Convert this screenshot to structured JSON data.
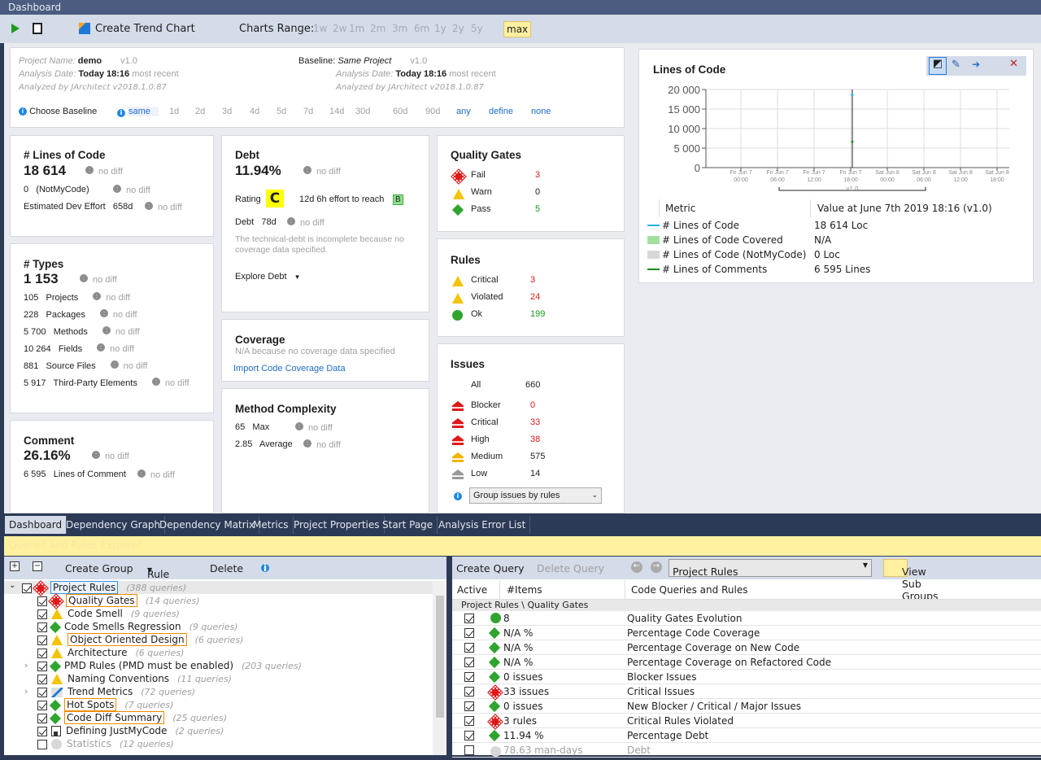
{
  "window": {
    "title": "Dashboard"
  },
  "toolbar": {
    "create_trend_chart": "Create Trend Chart",
    "charts_range_label": "Charts Range:",
    "ranges": [
      "1w",
      "2w",
      "1m",
      "2m",
      "3m",
      "6m",
      "1y",
      "2y",
      "5y",
      "max"
    ],
    "selected_range": "max"
  },
  "project": {
    "name_label": "Project Name:",
    "name": "demo",
    "version": "v1.0",
    "date_label": "Analysis Date:",
    "date": "Today 18:16",
    "recent": "most recent",
    "analyzed": "Analyzed by JArchitect v2018.1.0.87",
    "baseline_label": "Baseline:",
    "baseline": "Same Project",
    "baseline_version": "v1.0",
    "b_date": "Today 18:16",
    "b_recent": "most recent",
    "b_analyzed": "Analyzed by JArchitect v2018.1.0.87",
    "choose_baseline": "Choose Baseline",
    "baseline_options": [
      "same",
      "1d",
      "2d",
      "3d",
      "4d",
      "5d",
      "7d",
      "14d",
      "30d",
      "60d",
      "90d",
      "any",
      "define",
      "none"
    ]
  },
  "nodiff": "no diff",
  "loc": {
    "title": "# Lines of Code",
    "value": "18 614",
    "notmycode_value": "0",
    "notmycode_label": "(NotMyCode)",
    "effort_label": "Estimated Dev Effort",
    "effort": "658d"
  },
  "types": {
    "title": "# Types",
    "value": "1 153",
    "items": [
      {
        "v": "105",
        "l": "Projects"
      },
      {
        "v": "228",
        "l": "Packages"
      },
      {
        "v": "5 700",
        "l": "Methods"
      },
      {
        "v": "10 264",
        "l": "Fields"
      },
      {
        "v": "881",
        "l": "Source Files"
      },
      {
        "v": "5 917",
        "l": "Third-Party Elements"
      }
    ]
  },
  "comment": {
    "title": "Comment",
    "value": "26.16%",
    "lines_value": "6 595",
    "lines_label": "Lines of Comment"
  },
  "debt": {
    "title": "Debt",
    "value": "11.94%",
    "rating_label": "Rating",
    "rating": "C",
    "reach": "12d  6h effort to reach",
    "reach_rating": "B",
    "debt_label": "Debt",
    "debt_value": "78d",
    "note": "The technical-debt is incomplete because no coverage data specified.",
    "explore": "Explore Debt"
  },
  "coverage": {
    "title": "Coverage",
    "note": "N/A because no coverage data specified",
    "import": "Import Code Coverage Data"
  },
  "complexity": {
    "title": "Method Complexity",
    "max_value": "65",
    "max_label": "Max",
    "avg_value": "2.85",
    "avg_label": "Average"
  },
  "quality_gates": {
    "title": "Quality Gates",
    "items": [
      {
        "l": "Fail",
        "v": "3",
        "icon": "fail"
      },
      {
        "l": "Warn",
        "v": "0",
        "icon": "warn"
      },
      {
        "l": "Pass",
        "v": "5",
        "icon": "pass"
      }
    ]
  },
  "rules": {
    "title": "Rules",
    "items": [
      {
        "l": "Critical",
        "v": "3"
      },
      {
        "l": "Violated",
        "v": "24"
      },
      {
        "l": "Ok",
        "v": "199"
      }
    ]
  },
  "issues": {
    "title": "Issues",
    "all_label": "All",
    "all": "660",
    "items": [
      {
        "l": "Blocker",
        "v": "0"
      },
      {
        "l": "Critical",
        "v": "33"
      },
      {
        "l": "High",
        "v": "38"
      },
      {
        "l": "Medium",
        "v": "575"
      },
      {
        "l": "Low",
        "v": "14"
      }
    ],
    "group_select": "Group issues by rules"
  },
  "chart_data": {
    "type": "line",
    "title": "Lines of Code",
    "yticks": [
      "20 000",
      "15 000",
      "10 000",
      "5 000",
      "0"
    ],
    "ylim": [
      0,
      20000
    ],
    "xticks": [
      "Fri Jun 7 00:00",
      "Fri Jun 7 06:00",
      "Fri Jun 7 12:00",
      "Fri Jun 7 18:00",
      "Sat Jun 8 00:00",
      "Sat Jun 8 06:00",
      "Sat Jun 8 12:00",
      "Sat Jun 8 18:00"
    ],
    "version_marker": "v1.0",
    "series": [
      {
        "name": "# Lines of Code",
        "color": "#1eb4f0",
        "x": "Fri Jun 7 18:16",
        "y": 18614
      },
      {
        "name": "# Lines of Comments",
        "color": "#1a8a1a",
        "x": "Fri Jun 7 18:16",
        "y": 6595
      }
    ],
    "table": {
      "col1": "Metric",
      "col2": "Value at June 7th 2019  18:16  (v1.0)",
      "rows": [
        {
          "l": "# Lines of Code",
          "v": "18 614 Loc",
          "color": "#1eb4f0",
          "kind": "line"
        },
        {
          "l": "# Lines of Code Covered",
          "v": "N/A",
          "color": "#a0e0a0",
          "kind": "box"
        },
        {
          "l": "# Lines of Code (NotMyCode)",
          "v": "0 Loc",
          "color": "#d8d8d8",
          "kind": "box"
        },
        {
          "l": "# Lines of Comments",
          "v": "6 595 Lines",
          "color": "#1a8a1a",
          "kind": "line"
        }
      ]
    }
  },
  "tabs": [
    "Dashboard",
    "Dependency Graph",
    "Dependency Matrix",
    "Metrics",
    "Project Properties",
    "Start Page",
    "Analysis Error List"
  ],
  "explorer": {
    "title": "Queries and Rules Explorer",
    "create_group": "Create Group",
    "rule_file": "Rule File",
    "delete": "Delete",
    "tree": [
      {
        "l": "Project Rules",
        "q": "(388 queries)",
        "icon": "fail",
        "boxed": true,
        "on": true,
        "level": 0
      },
      {
        "l": "Quality Gates",
        "q": "(14 queries)",
        "icon": "fail",
        "boxed": true,
        "on": true,
        "level": 1
      },
      {
        "l": "Code Smell",
        "q": "(9 queries)",
        "icon": "warn",
        "on": true,
        "level": 1
      },
      {
        "l": "Code Smells Regression",
        "q": "(9 queries)",
        "icon": "pass",
        "on": true,
        "level": 1
      },
      {
        "l": "Object Oriented Design",
        "q": "(6 queries)",
        "icon": "warn",
        "boxed": true,
        "on": true,
        "level": 1
      },
      {
        "l": "Architecture",
        "q": "(6 queries)",
        "icon": "warn",
        "on": true,
        "level": 1
      },
      {
        "l": "PMD Rules (PMD must be enabled)",
        "q": "(203 queries)",
        "icon": "pass",
        "on": true,
        "level": 1,
        "exp": true
      },
      {
        "l": "Naming Conventions",
        "q": "(11 queries)",
        "icon": "warn",
        "on": true,
        "level": 1
      },
      {
        "l": "Trend Metrics",
        "q": "(72 queries)",
        "icon": "trend",
        "on": true,
        "level": 1,
        "exp": true
      },
      {
        "l": "Hot Spots",
        "q": "(7 queries)",
        "icon": "pass",
        "boxed": true,
        "on": true,
        "level": 1
      },
      {
        "l": "Code Diff Summary",
        "q": "(25 queries)",
        "icon": "pass",
        "boxed": true,
        "on": true,
        "level": 1
      },
      {
        "l": "Defining JustMyCode",
        "q": "(2 queries)",
        "icon": "doc",
        "on": true,
        "level": 1
      },
      {
        "l": "Statistics",
        "q": "(12 queries)",
        "icon": "grey",
        "on": false,
        "level": 1,
        "dim": true
      }
    ]
  },
  "queries": {
    "create_query": "Create Query",
    "delete_query": "Delete Query",
    "group_select": "Project Rules",
    "view_sub_groups": "View Sub Groups",
    "col_active": "Active",
    "col_items": "#Items",
    "col_name": "Code Queries and Rules",
    "group_path": "Project Rules \\ Quality Gates",
    "rows": [
      {
        "i": "8",
        "n": "Quality Gates Evolution",
        "icon": "pass-circle",
        "on": true
      },
      {
        "i": "N/A %",
        "n": "Percentage Code Coverage",
        "icon": "pass",
        "on": true
      },
      {
        "i": "N/A %",
        "n": "Percentage Coverage on New Code",
        "icon": "pass",
        "on": true
      },
      {
        "i": "N/A %",
        "n": "Percentage Coverage on Refactored Code",
        "icon": "pass",
        "on": true
      },
      {
        "i": "0 issues",
        "n": "Blocker Issues",
        "icon": "pass",
        "on": true
      },
      {
        "i": "33 issues",
        "n": "Critical Issues",
        "icon": "fail",
        "on": true
      },
      {
        "i": "0 issues",
        "n": "New Blocker / Critical / Major Issues",
        "icon": "pass",
        "on": true
      },
      {
        "i": "3 rules",
        "n": "Critical Rules Violated",
        "icon": "fail",
        "on": true
      },
      {
        "i": "11.94 %",
        "n": "Percentage Debt",
        "icon": "pass",
        "on": true
      },
      {
        "i": "78.63 man-days",
        "n": "Debt",
        "icon": "grey",
        "on": false,
        "dim": true
      }
    ]
  }
}
